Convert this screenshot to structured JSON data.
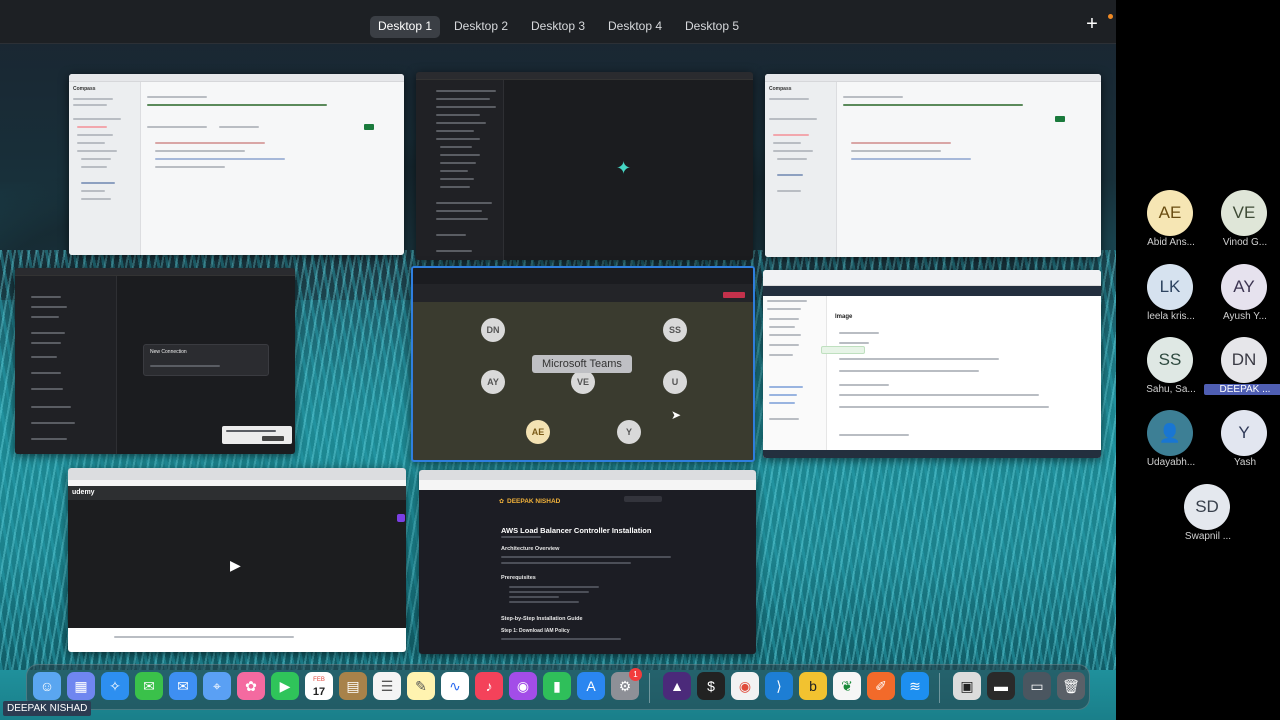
{
  "spaces": {
    "desktops": [
      "Desktop 1",
      "Desktop 2",
      "Desktop 3",
      "Desktop 4",
      "Desktop 5"
    ],
    "active": "Desktop 1",
    "add_label": "+"
  },
  "windows": {
    "compass_title": "Compass",
    "teams_badge": "Microsoft Teams",
    "teams_participants": [
      "DN",
      "SS",
      "AY",
      "VE",
      "U",
      "AE",
      "Y"
    ],
    "blog_logo": "DEEPAK NISHAD",
    "blog_title": "AWS Load Balancer Controller Installation",
    "blog_sections": [
      "Architecture Overview",
      "Prerequisites",
      "Step-by-Step Installation Guide",
      "Step 1: Download IAM Policy"
    ],
    "ecr_heading": "Image",
    "udemy_logo": "udemy",
    "new_connection_title": "New Connection"
  },
  "dock": {
    "calendar_month": "FEB",
    "calendar_day": "17",
    "badge_count": "1"
  },
  "user_label": "DEEPAK NISHAD",
  "participants": [
    {
      "initials": "AE",
      "name": "Abid Ans...",
      "bg": "#f6e6b4",
      "fg": "#6a4d12"
    },
    {
      "initials": "VE",
      "name": "Vinod G...",
      "bg": "#dfe6d8",
      "fg": "#3e4b36"
    },
    {
      "initials": "LK",
      "name": "leela kris...",
      "bg": "#d6e2ef",
      "fg": "#2e4460"
    },
    {
      "initials": "AY",
      "name": "Ayush Y...",
      "bg": "#e6e2ee",
      "fg": "#3d3552"
    },
    {
      "initials": "SS",
      "name": "Sahu, Sa...",
      "bg": "#dfe8e4",
      "fg": "#2f4a40"
    },
    {
      "initials": "DN",
      "name": "DEEPAK ...",
      "bg": "#e6e6ea",
      "fg": "#3a3a44"
    },
    {
      "initials": "",
      "name": "Udayabh...",
      "bg": "#3d7f95",
      "fg": "#ffffff"
    },
    {
      "initials": "Y",
      "name": "Yash",
      "bg": "#e2e6f0",
      "fg": "#303a58"
    },
    {
      "initials": "SD",
      "name": "Swapnil ...",
      "bg": "#e4e8ee",
      "fg": "#38404c"
    }
  ]
}
